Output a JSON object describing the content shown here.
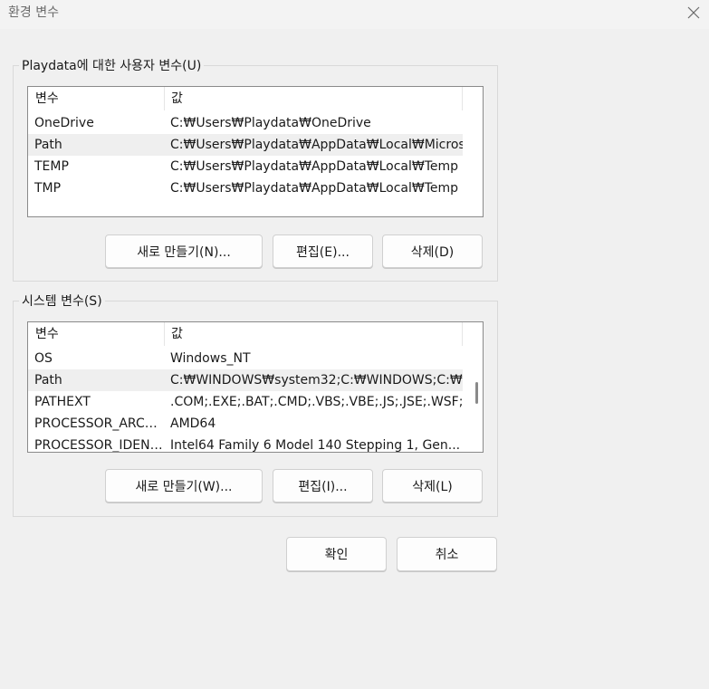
{
  "window": {
    "title": "환경 변수",
    "close_icon": "close-icon"
  },
  "user_vars": {
    "group_label": "Playdata에 대한 사용자 변수(U)",
    "columns": [
      "변수",
      "값"
    ],
    "rows": [
      {
        "name": "OneDrive",
        "value": "C:₩Users₩Playdata₩OneDrive"
      },
      {
        "name": "Path",
        "value": "C:₩Users₩Playdata₩AppData₩Local₩Micros..."
      },
      {
        "name": "TEMP",
        "value": "C:₩Users₩Playdata₩AppData₩Local₩Temp"
      },
      {
        "name": "TMP",
        "value": "C:₩Users₩Playdata₩AppData₩Local₩Temp"
      }
    ],
    "selected_row": "Path",
    "buttons": {
      "new": "새로 만들기(N)...",
      "edit": "편집(E)...",
      "delete": "삭제(D)"
    }
  },
  "system_vars": {
    "group_label": "시스템 변수(S)",
    "columns": [
      "변수",
      "값"
    ],
    "rows": [
      {
        "name": "OS",
        "value": "Windows_NT"
      },
      {
        "name": "Path",
        "value": "C:₩WINDOWS₩system32;C:₩WINDOWS;C:₩..."
      },
      {
        "name": "PATHEXT",
        "value": ".COM;.EXE;.BAT;.CMD;.VBS;.VBE;.JS;.JSE;.WSF;..."
      },
      {
        "name": "PROCESSOR_ARCH...",
        "value": "AMD64"
      },
      {
        "name": "PROCESSOR_IDENT...",
        "value": "Intel64 Family 6 Model 140 Stepping 1, Gen..."
      }
    ],
    "selected_row": "Path",
    "buttons": {
      "new": "새로 만들기(W)...",
      "edit": "편집(I)...",
      "delete": "삭제(L)"
    }
  },
  "footer": {
    "ok": "확인",
    "cancel": "취소"
  }
}
